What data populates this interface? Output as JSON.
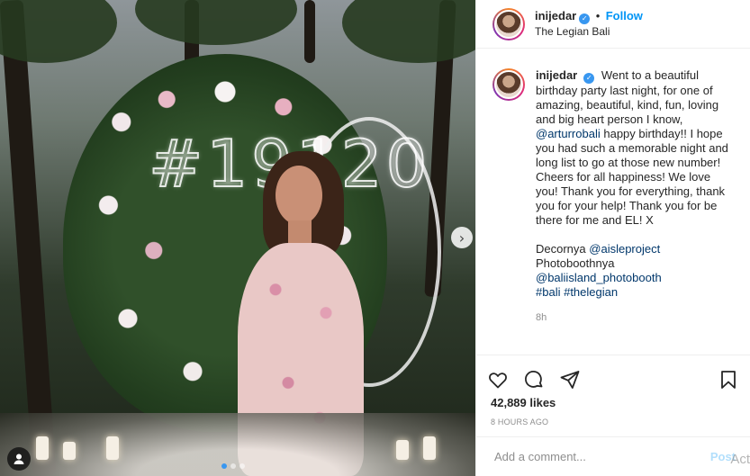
{
  "post": {
    "image": {
      "neon_sign": "#19120",
      "next_arrow": "›"
    },
    "header": {
      "username": "inijedar",
      "separator": "•",
      "follow_label": "Follow",
      "location": "The Legian Bali"
    },
    "caption": {
      "username": "inijedar",
      "text_1": "Went to a beautiful birthday party last night, for one of amazing, beautiful, kind, fun, loving and big heart person I know,",
      "mention_1": "@arturrobali",
      "text_2": "happy birthday!! I hope you had such a memorable night and long list to go at those new number! Cheers for all happiness! We love you! Thank you for everything, thank you for your help! Thank you for be there for me and EL! X",
      "decor_label": "Decornya",
      "mention_2": "@aisleproject",
      "photobooth_label": "Photoboothnya",
      "mention_3": "@baliisland_photobooth",
      "hashtag_1": "#bali",
      "hashtag_2": "#thelegian",
      "time": "8h"
    },
    "stats": {
      "likes": "42,889 likes",
      "posted_ago": "8 HOURS AGO"
    },
    "comment": {
      "placeholder": "Add a comment...",
      "post_label": "Post"
    },
    "watermark": "Act",
    "colors": {
      "link": "#00376b",
      "follow": "#0095f6",
      "verified": "#3897f0"
    },
    "icons": [
      "heart-icon",
      "comment-icon",
      "share-icon",
      "bookmark-icon",
      "verified-badge-icon",
      "tag-user-icon",
      "next-arrow-icon"
    ]
  }
}
